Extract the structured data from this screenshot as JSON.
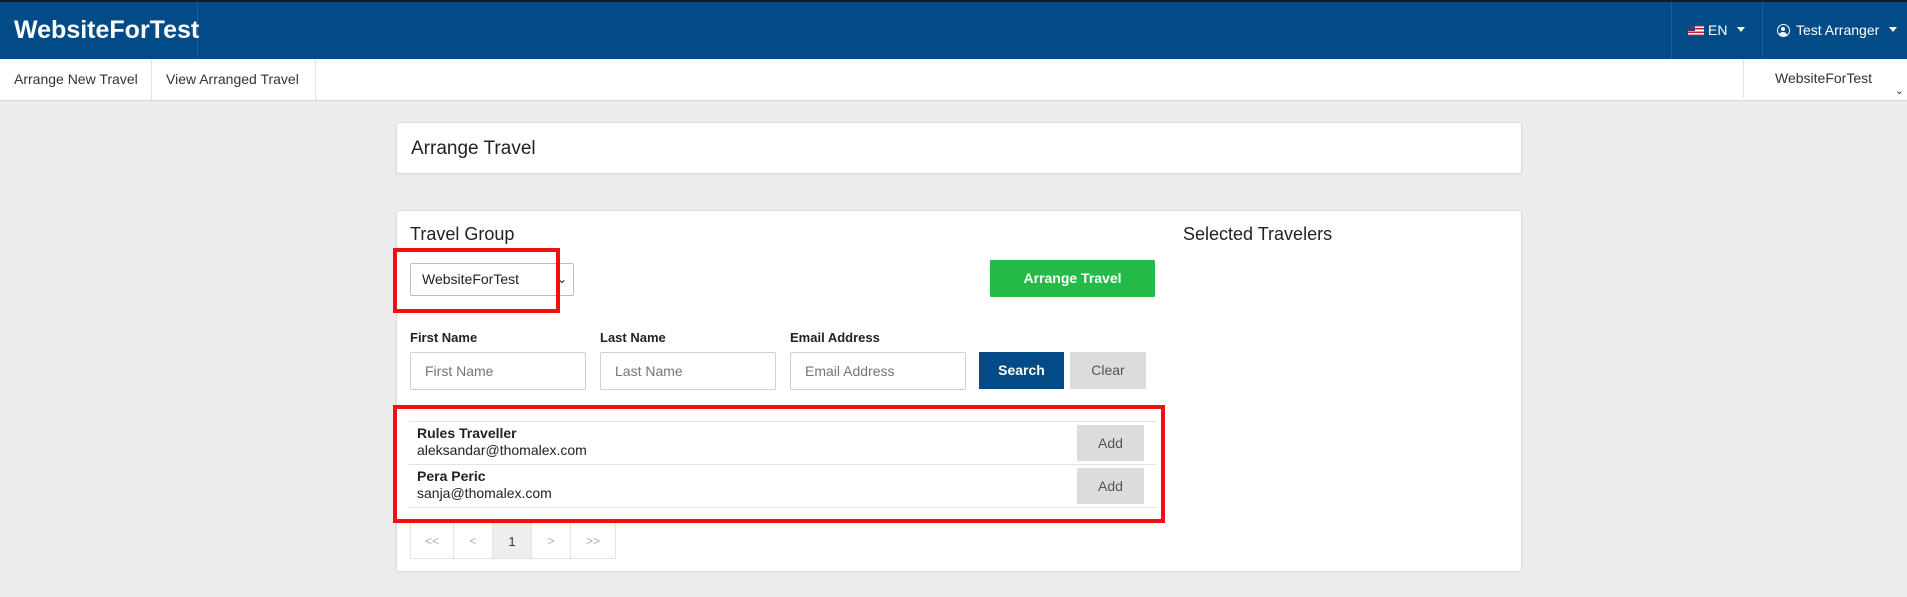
{
  "header": {
    "brand": "WebsiteForTest",
    "language": "EN",
    "user": "Test Arranger",
    "colors": {
      "bar": "#024b87",
      "primary_button": "#024b87",
      "arrange_button": "#23bb45",
      "highlight": "#ef1010"
    }
  },
  "nav": {
    "items": [
      "Arrange New Travel",
      "View Arranged Travel"
    ],
    "site_selector": "WebsiteForTest"
  },
  "page": {
    "title": "Arrange Travel"
  },
  "travel_group": {
    "heading": "Travel Group",
    "selected": "WebsiteForTest",
    "arrange_button": "Arrange Travel"
  },
  "selected_travelers": {
    "heading": "Selected Travelers"
  },
  "search": {
    "first_name": {
      "label": "First Name",
      "placeholder": "First Name"
    },
    "last_name": {
      "label": "Last Name",
      "placeholder": "Last Name"
    },
    "email": {
      "label": "Email Address",
      "placeholder": "Email Address"
    },
    "search_button": "Search",
    "clear_button": "Clear"
  },
  "results": [
    {
      "name": "Rules Traveller",
      "email": "aleksandar@thomalex.com",
      "action": "Add"
    },
    {
      "name": "Pera Peric",
      "email": "sanja@thomalex.com",
      "action": "Add"
    }
  ],
  "pagination": {
    "first": "<<",
    "prev": "<",
    "current": "1",
    "next": ">",
    "last": ">>"
  },
  "icons": {
    "language_flag": "us-flag-icon",
    "user": "user-circle-icon",
    "dropdown": "caret-down-icon"
  }
}
